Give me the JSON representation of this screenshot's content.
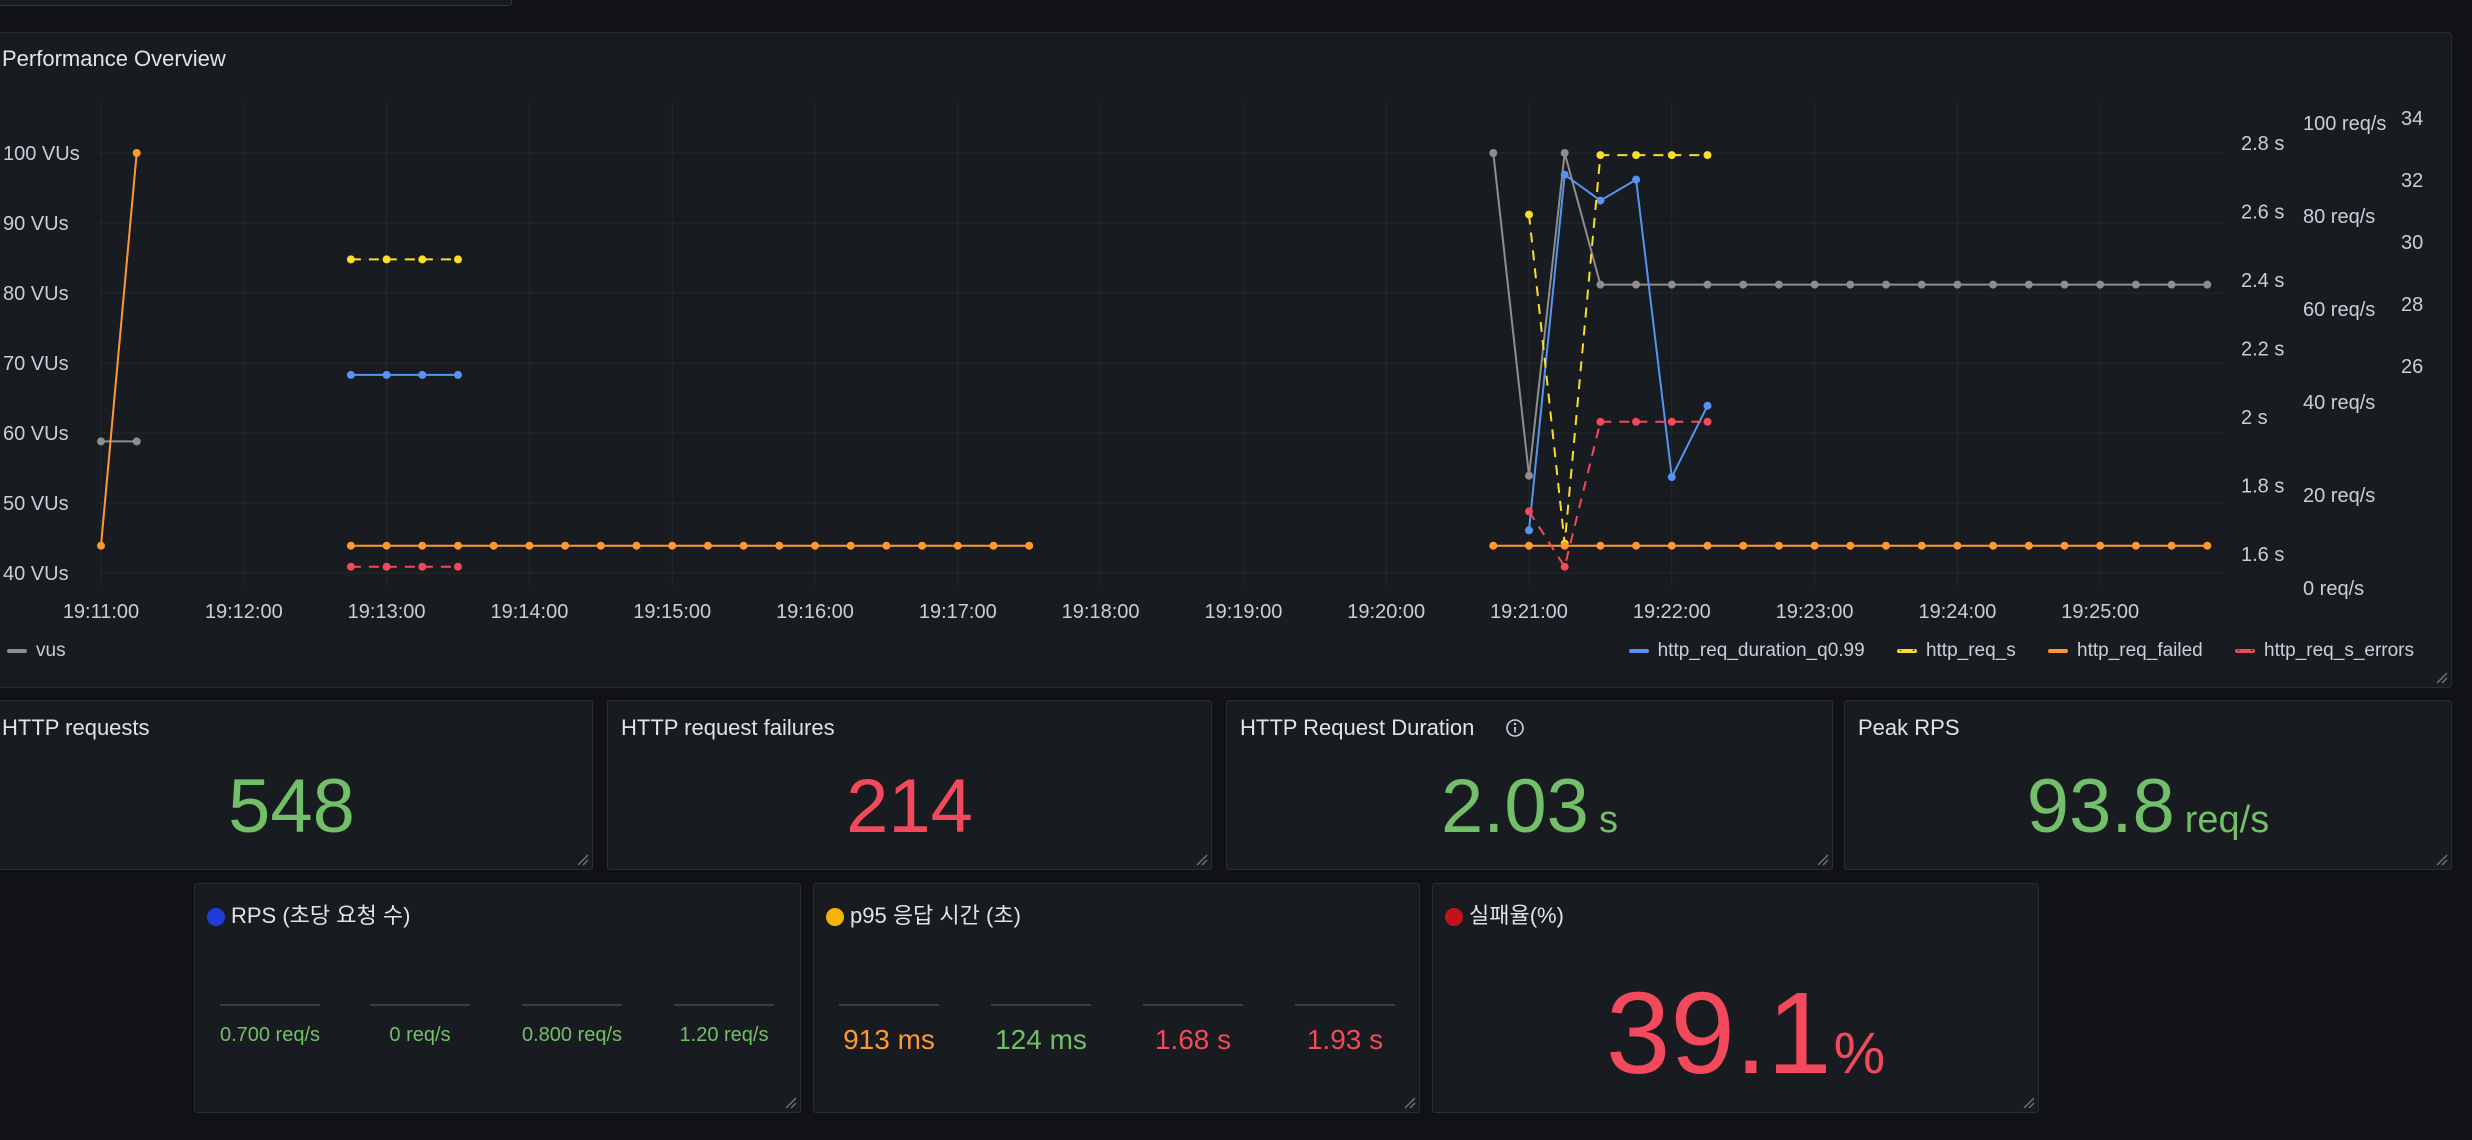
{
  "colors": {
    "vus": "#8e8e8e",
    "duration": "#5794f2",
    "reqs": "#fade2a",
    "failed": "#ff9830",
    "errors": "#f2495c",
    "green": "#73bf69",
    "red": "#f2495c"
  },
  "performance": {
    "title": "Performance Overview",
    "legend_left": [
      "vus"
    ],
    "legend_right": [
      "http_req_duration_q0.99",
      "http_req_s",
      "http_req_failed",
      "http_req_s_errors"
    ],
    "chart_data": {
      "type": "line",
      "x_ticks": [
        "19:11:00",
        "19:12:00",
        "19:13:00",
        "19:14:00",
        "19:15:00",
        "19:16:00",
        "19:17:00",
        "19:18:00",
        "19:19:00",
        "19:20:00",
        "19:21:00",
        "19:22:00",
        "19:23:00",
        "19:24:00",
        "19:25:00"
      ],
      "left_axis": {
        "unit": "VUs",
        "ticks": [
          "100 VUs",
          "90 VUs",
          "80 VUs",
          "70 VUs",
          "60 VUs",
          "50 VUs",
          "40 VUs"
        ],
        "range": [
          40,
          100
        ]
      },
      "right_axis_1": {
        "unit": "s",
        "ticks": [
          "2.8 s",
          "2.6 s",
          "2.4 s",
          "2.2 s",
          "2 s",
          "1.8 s",
          "1.6 s"
        ],
        "range": [
          1.6,
          2.8
        ]
      },
      "right_axis_2": {
        "unit": "req/s",
        "ticks": [
          "100 req/s",
          "80 req/s",
          "60 req/s",
          "40 req/s",
          "20 req/s",
          "0 req/s"
        ],
        "range": [
          0,
          100
        ]
      },
      "right_axis_3": {
        "ticks": [
          "34",
          "32",
          "30",
          "28",
          "26"
        ],
        "range": [
          24,
          34
        ]
      },
      "series": [
        {
          "name": "vus",
          "segments": [
            [
              [
                "19:11:00",
                58.8
              ],
              [
                "19:11:15",
                58.8
              ]
            ],
            [
              [
                "19:20:45",
                100
              ],
              [
                "19:21:00",
                53.9
              ],
              [
                "19:21:15",
                100
              ],
              [
                "19:21:30",
                81.2
              ],
              [
                "19:21:45",
                81.2
              ],
              [
                "19:22:00",
                81.2
              ],
              [
                "19:22:15",
                81.2
              ],
              [
                "19:22:30",
                81.2
              ],
              [
                "19:22:45",
                81.2
              ],
              [
                "19:23:00",
                81.2
              ],
              [
                "19:23:15",
                81.2
              ],
              [
                "19:23:30",
                81.2
              ],
              [
                "19:23:45",
                81.2
              ],
              [
                "19:24:00",
                81.2
              ],
              [
                "19:24:15",
                81.2
              ],
              [
                "19:24:30",
                81.2
              ],
              [
                "19:24:45",
                81.2
              ],
              [
                "19:25:00",
                81.2
              ],
              [
                "19:25:15",
                81.2
              ],
              [
                "19:25:30",
                81.2
              ],
              [
                "19:25:45",
                81.2
              ]
            ]
          ]
        },
        {
          "name": "http_req_duration_q0.99",
          "segments": [
            [
              [
                "19:12:45",
                68.3
              ],
              [
                "19:13:00",
                68.3
              ],
              [
                "19:13:15",
                68.3
              ],
              [
                "19:13:30",
                68.3
              ]
            ],
            [
              [
                "19:21:00",
                46.1
              ],
              [
                "19:21:15",
                96.9
              ],
              [
                "19:21:30",
                93.2
              ],
              [
                "19:21:45",
                96.2
              ],
              [
                "19:22:00",
                53.7
              ],
              [
                "19:22:15",
                63.9
              ]
            ]
          ]
        },
        {
          "name": "http_req_s",
          "dashed": true,
          "segments": [
            [
              [
                "19:12:45",
                84.8
              ],
              [
                "19:13:00",
                84.8
              ],
              [
                "19:13:15",
                84.8
              ],
              [
                "19:13:30",
                84.8
              ]
            ],
            [
              [
                "19:21:00",
                91.2
              ],
              [
                "19:21:15",
                44.2
              ],
              [
                "19:21:30",
                99.7
              ],
              [
                "19:21:45",
                99.7
              ],
              [
                "19:22:00",
                99.7
              ],
              [
                "19:22:15",
                99.7
              ]
            ]
          ]
        },
        {
          "name": "http_req_failed",
          "segments": [
            [
              [
                "19:11:00",
                43.9
              ],
              [
                "19:11:15",
                100
              ]
            ],
            [
              [
                "19:12:45",
                43.9
              ],
              [
                "19:13:00",
                43.9
              ],
              [
                "19:13:15",
                43.9
              ],
              [
                "19:13:30",
                43.9
              ],
              [
                "19:13:45",
                43.9
              ],
              [
                "19:14:00",
                43.9
              ],
              [
                "19:14:15",
                43.9
              ],
              [
                "19:14:30",
                43.9
              ],
              [
                "19:14:45",
                43.9
              ],
              [
                "19:15:00",
                43.9
              ],
              [
                "19:15:15",
                43.9
              ],
              [
                "19:15:30",
                43.9
              ],
              [
                "19:15:45",
                43.9
              ],
              [
                "19:16:00",
                43.9
              ],
              [
                "19:16:15",
                43.9
              ],
              [
                "19:16:30",
                43.9
              ],
              [
                "19:16:45",
                43.9
              ],
              [
                "19:17:00",
                43.9
              ],
              [
                "19:17:15",
                43.9
              ],
              [
                "19:17:30",
                43.9
              ]
            ],
            [
              [
                "19:20:45",
                43.9
              ],
              [
                "19:21:00",
                43.9
              ],
              [
                "19:21:15",
                43.9
              ],
              [
                "19:21:30",
                43.9
              ],
              [
                "19:21:45",
                43.9
              ],
              [
                "19:22:00",
                43.9
              ],
              [
                "19:22:15",
                43.9
              ],
              [
                "19:22:30",
                43.9
              ],
              [
                "19:22:45",
                43.9
              ],
              [
                "19:23:00",
                43.9
              ],
              [
                "19:23:15",
                43.9
              ],
              [
                "19:23:30",
                43.9
              ],
              [
                "19:23:45",
                43.9
              ],
              [
                "19:24:00",
                43.9
              ],
              [
                "19:24:15",
                43.9
              ],
              [
                "19:24:30",
                43.9
              ],
              [
                "19:24:45",
                43.9
              ],
              [
                "19:25:00",
                43.9
              ],
              [
                "19:25:15",
                43.9
              ],
              [
                "19:25:30",
                43.9
              ],
              [
                "19:25:45",
                43.9
              ]
            ]
          ]
        },
        {
          "name": "http_req_s_errors",
          "dashed": true,
          "segments": [
            [
              [
                "19:12:45",
                40.9
              ],
              [
                "19:13:00",
                40.9
              ],
              [
                "19:13:15",
                40.9
              ],
              [
                "19:13:30",
                40.9
              ]
            ],
            [
              [
                "19:21:00",
                48.8
              ],
              [
                "19:21:15",
                40.9
              ],
              [
                "19:21:30",
                61.6
              ],
              [
                "19:21:45",
                61.6
              ],
              [
                "19:22:00",
                61.6
              ],
              [
                "19:22:15",
                61.6
              ]
            ]
          ]
        }
      ]
    }
  },
  "stats": [
    {
      "title": "HTTP requests",
      "value": "548",
      "unit": "",
      "color": "green"
    },
    {
      "title": "HTTP request failures",
      "value": "214",
      "unit": "",
      "color": "red"
    },
    {
      "title": "HTTP Request Duration",
      "value": "2.03",
      "unit": "s",
      "color": "green"
    },
    {
      "title": "Peak RPS",
      "value": "93.8",
      "unit": "req/s",
      "color": "green"
    }
  ],
  "rps_panel": {
    "title": "RPS (초당 요청 수)",
    "dot_color": "#1f3cd8",
    "values": [
      "0.700 req/s",
      "0 req/s",
      "0.800 req/s",
      "1.20 req/s"
    ]
  },
  "p95_panel": {
    "title": "p95 응답 시간 (초)",
    "dot_color": "#f5b400",
    "values": [
      "913 ms",
      "124 ms",
      "1.68 s",
      "1.93 s"
    ],
    "colors": [
      "orange",
      "green",
      "red",
      "red"
    ]
  },
  "fail_panel": {
    "title": "실패율(%)",
    "dot_color": "#c4121c",
    "value": "39.1",
    "unit": "%"
  }
}
